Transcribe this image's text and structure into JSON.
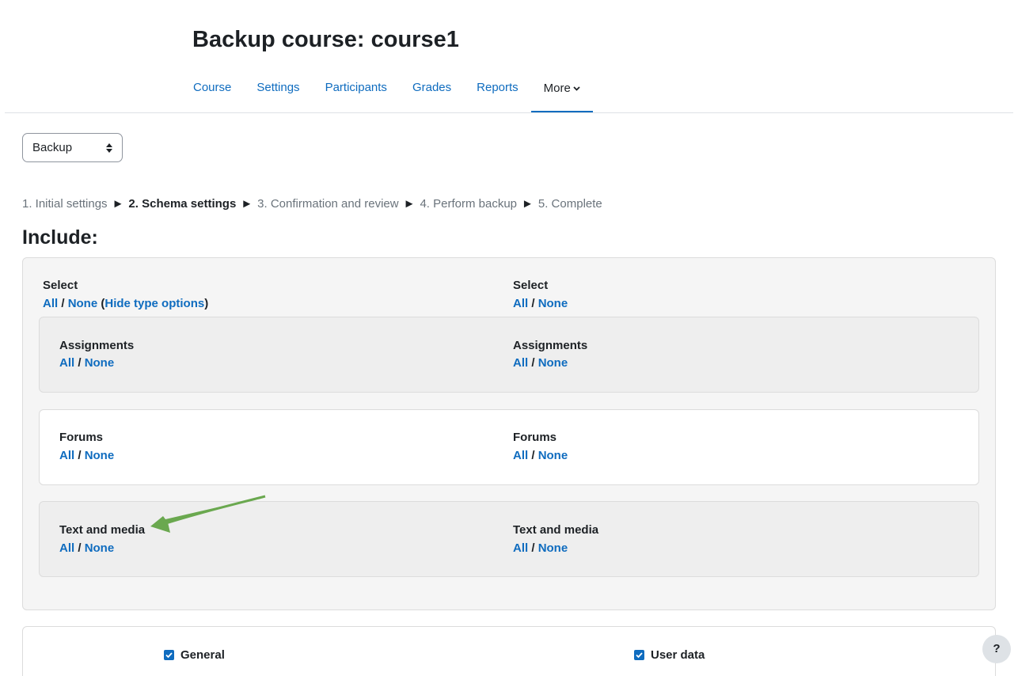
{
  "page": {
    "title": "Backup course: course1"
  },
  "nav": {
    "items": [
      "Course",
      "Settings",
      "Participants",
      "Grades",
      "Reports"
    ],
    "more": "More"
  },
  "selector": {
    "value": "Backup"
  },
  "progress": {
    "step1": "1. Initial settings",
    "step2": "2. Schema settings",
    "step3": "3. Confirmation and review",
    "step4": "4. Perform backup",
    "step5": "5. Complete",
    "separator": "►"
  },
  "include": {
    "heading": "Include:",
    "select_label": "Select",
    "all": "All",
    "none": "None",
    "slash": "/",
    "hide_type_options": "Hide type options",
    "groups": [
      {
        "name": "Assignments"
      },
      {
        "name": "Forums"
      },
      {
        "name": "Text and media"
      }
    ]
  },
  "settings": {
    "general": "General",
    "user_data": "User data"
  },
  "help": {
    "label": "?"
  },
  "colors": {
    "link": "#0f6cbf",
    "annotation_arrow": "#6aa84f"
  }
}
